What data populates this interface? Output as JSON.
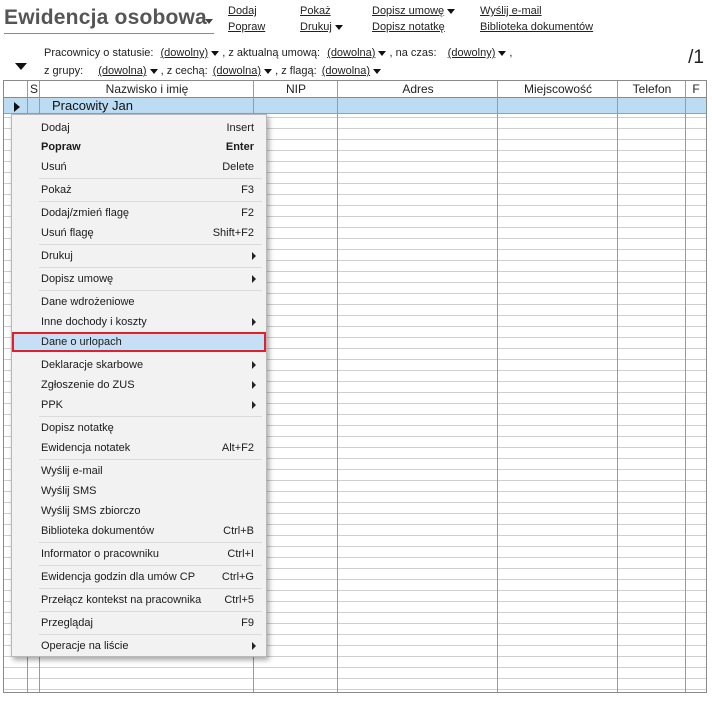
{
  "app": {
    "title": "Ewidencja osobowa",
    "page_count": "/1"
  },
  "toolbar": {
    "dodaj": "Dodaj",
    "popraw": "Popraw",
    "pokaz": "Pokaż",
    "drukuj": "Drukuj",
    "dopisz_umowe": "Dopisz umowę",
    "dopisz_notatke": "Dopisz notatkę",
    "wyslij_email": "Wyślij e-mail",
    "biblioteka": "Biblioteka dokumentów"
  },
  "filters": {
    "status_label": "Pracownicy o statusie:",
    "status_value": "(dowolny)",
    "umowa_label": ", z aktualną umową:",
    "umowa_value": "(dowolna)",
    "czas_label": ", na czas:",
    "czas_value": "(dowolny)",
    "czas_suffix": ",",
    "grupy_label": "z grupy:",
    "grupy_value": "(dowolna)",
    "cecha_label": ", z cechą:",
    "cecha_value": "(dowolna)",
    "flaga_label": ", z flagą:",
    "flaga_value": "(dowolna)"
  },
  "grid": {
    "columns": [
      "S",
      "Nazwisko i imię",
      "NIP",
      "Adres",
      "Miejscowość",
      "Telefon",
      "F"
    ],
    "selected_row": {
      "name": "Pracowity Jan"
    }
  },
  "context_menu": {
    "items": [
      {
        "label": "Dodaj",
        "shortcut": "Insert"
      },
      {
        "label": "Popraw",
        "shortcut": "Enter",
        "bold": true
      },
      {
        "label": "Usuń",
        "shortcut": "Delete"
      },
      {
        "label": "Pokaż",
        "shortcut": "F3"
      },
      {
        "label": "Dodaj/zmień flagę",
        "shortcut": "F2"
      },
      {
        "label": "Usuń flagę",
        "shortcut": "Shift+F2"
      },
      {
        "label": "Drukuj",
        "submenu": true
      },
      {
        "label": "Dopisz umowę",
        "submenu": true
      },
      {
        "label": "Dane wdrożeniowe"
      },
      {
        "label": "Inne dochody i koszty",
        "submenu": true
      },
      {
        "label": "Dane o urlopach",
        "highlighted": true
      },
      {
        "label": "Deklaracje skarbowe",
        "submenu": true
      },
      {
        "label": "Zgłoszenie do ZUS",
        "submenu": true
      },
      {
        "label": "PPK",
        "submenu": true
      },
      {
        "label": "Dopisz notatkę"
      },
      {
        "label": "Ewidencja notatek",
        "shortcut": "Alt+F2"
      },
      {
        "label": "Wyślij e-mail"
      },
      {
        "label": "Wyślij SMS"
      },
      {
        "label": "Wyślij SMS zbiorczo"
      },
      {
        "label": "Biblioteka dokumentów",
        "shortcut": "Ctrl+B"
      },
      {
        "label": "Informator o pracowniku",
        "shortcut": "Ctrl+I"
      },
      {
        "label": "Ewidencja godzin dla umów CP",
        "shortcut": "Ctrl+G"
      },
      {
        "label": "Przełącz kontekst na pracownika",
        "shortcut": "Ctrl+5"
      },
      {
        "label": "Przeglądaj",
        "shortcut": "F9"
      },
      {
        "label": "Operacje na liście",
        "submenu": true
      }
    ]
  },
  "colors": {
    "selection": "#bcdcf3",
    "highlight_border": "#e0202a",
    "menu_bg": "#f2f2f2"
  }
}
